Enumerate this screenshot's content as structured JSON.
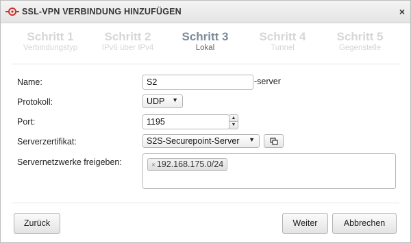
{
  "window": {
    "title": "SSL-VPN VERBINDUNG HINZUFÜGEN",
    "close_glyph": "×",
    "logo_color": "#c9302c"
  },
  "steps": [
    {
      "num": "Schritt 1",
      "sub": "Verbindungstyp"
    },
    {
      "num": "Schritt 2",
      "sub": "IPv6 über IPv4"
    },
    {
      "num": "Schritt 3",
      "sub": "Lokal"
    },
    {
      "num": "Schritt 4",
      "sub": "Tunnel"
    },
    {
      "num": "Schritt 5",
      "sub": "Gegenstelle"
    }
  ],
  "active_step_color": "#7b8a99",
  "form": {
    "name_label": "Name:",
    "name_value": "S2",
    "name_suffix": "-server",
    "protocol_label": "Protokoll:",
    "protocol_value": "UDP",
    "port_label": "Port:",
    "port_value": "1195",
    "cert_label": "Serverzertifikat:",
    "cert_value": "S2S-Securepoint-Server",
    "networks_label": "Servernetzwerke freigeben:",
    "networks": [
      "192.168.175.0/24"
    ],
    "icons": {
      "dropdown": "▼",
      "spin_up": "▲",
      "spin_down": "▼",
      "tag_remove": "×",
      "cert_action": "copy-icon"
    }
  },
  "buttons": {
    "back": "Zurück",
    "next": "Weiter",
    "cancel": "Abbrechen"
  }
}
